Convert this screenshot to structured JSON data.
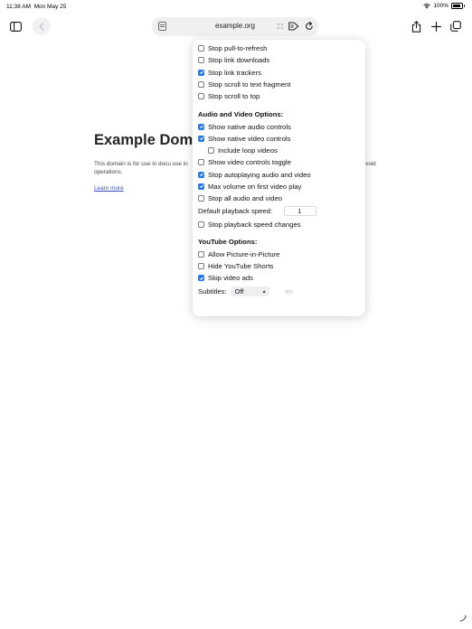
{
  "status_bar": {
    "time": "11:38 AM",
    "date": "Mon May 25",
    "battery": "100%"
  },
  "toolbar": {
    "address": "example.org",
    "icons": [
      "sidebar-icon",
      "back-icon",
      "page-icon",
      "translate-icon",
      "reader-icon",
      "reload-icon",
      "share-icon",
      "plus-icon",
      "tabs-icon"
    ]
  },
  "page": {
    "heading": "Example Doma",
    "paragraph": "This domain is for use in docu use in operations.",
    "paragraph_tail": "void",
    "link": "Learn more"
  },
  "popup": {
    "top_options": [
      {
        "label": "Stop pull-to-refresh",
        "checked": false
      },
      {
        "label": "Stop link downloads",
        "checked": false
      },
      {
        "label": "Stop link trackers",
        "checked": true
      },
      {
        "label": "Stop scroll to text fragment",
        "checked": false
      },
      {
        "label": "Stop scroll to top",
        "checked": false
      }
    ],
    "av_heading": "Audio and Video Options:",
    "av_options": [
      {
        "label": "Show native audio controls",
        "checked": true,
        "indent": false
      },
      {
        "label": "Show native video controls",
        "checked": true,
        "indent": false
      },
      {
        "label": "Include loop videos",
        "checked": false,
        "indent": true
      },
      {
        "label": "Show video controls toggle",
        "checked": false,
        "indent": false
      },
      {
        "label": "Stop autoplaying audio and video",
        "checked": true,
        "indent": false
      },
      {
        "label": "Max volume on first video play",
        "checked": true,
        "indent": false
      },
      {
        "label": "Stop all audio and video",
        "checked": false,
        "indent": false
      }
    ],
    "playback_label": "Default playback speed:",
    "playback_value": "1",
    "playback_option": {
      "label": "Stop playback speed changes",
      "checked": false
    },
    "yt_heading": "YouTube Options:",
    "yt_options": [
      {
        "label": "Allow Picture-in-Picture",
        "checked": false
      },
      {
        "label": "Hide YouTube Shorts",
        "checked": false
      },
      {
        "label": "Skip video ads",
        "checked": true
      }
    ],
    "subtitles_label": "Subtitles:",
    "subtitles_value": "Off",
    "subtitles_lang_placeholder": "en"
  },
  "colors": {
    "accent": "#1e7cf0",
    "link": "#3b4db8"
  }
}
